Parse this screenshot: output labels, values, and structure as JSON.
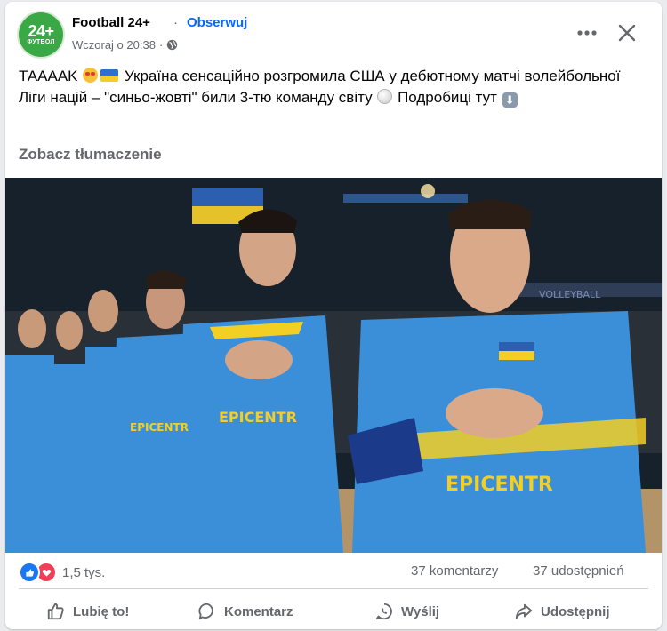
{
  "header": {
    "avatar_big": "24+",
    "avatar_small": "ФУТБОЛ",
    "page_name": "Football 24+",
    "separator": "·",
    "follow_label": "Obserwuj",
    "timestamp": "Wczoraj o 20:38",
    "meta_separator": "·",
    "privacy_icon": "globe-icon",
    "more_icon": "more-options-icon",
    "close_icon": "close-icon"
  },
  "post": {
    "text_part1": "ТАААAK",
    "text_part2": "Україна сенсаційно розгромила США у дебютному матчі волейбольної Ліги націй – \"синьо-жовті\" били 3-тю команду світу",
    "text_part3": "Подробиці тут",
    "translate_label": "Zobacz tłumaczenie"
  },
  "stats": {
    "reactions_count": "1,5 tys.",
    "comments": "37 komentarzy",
    "shares": "37 udostępnień"
  },
  "actions": {
    "like": "Lubię to!",
    "comment": "Komentarz",
    "send": "Wyślij",
    "share": "Udostępnij"
  },
  "colors": {
    "brand_blue": "#0866ff",
    "jersey_blue": "#3b8fd9",
    "jersey_yellow": "#f3cf25",
    "avatar_green": "#3aa845"
  }
}
